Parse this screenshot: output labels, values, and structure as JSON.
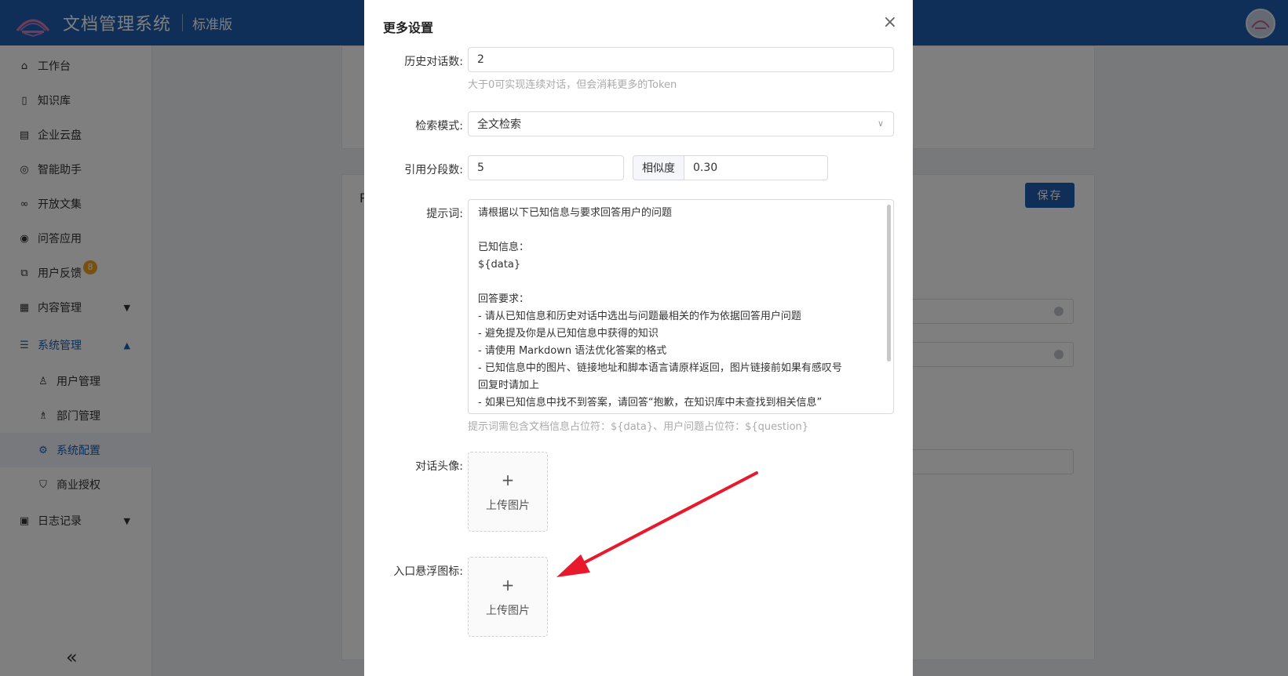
{
  "header": {
    "app_title": "文档管理系统",
    "edition": "标准版"
  },
  "sidebar": {
    "items": [
      {
        "label": "工作台",
        "icon": "home-icon"
      },
      {
        "label": "知识库",
        "icon": "book-icon"
      },
      {
        "label": "企业云盘",
        "icon": "cloud-drive-icon"
      },
      {
        "label": "智能助手",
        "icon": "chat-icon"
      },
      {
        "label": "开放文集",
        "icon": "share-icon"
      },
      {
        "label": "问答应用",
        "icon": "qa-icon"
      },
      {
        "label": "用户反馈",
        "icon": "feedback-icon",
        "badge": "8"
      },
      {
        "label": "内容管理",
        "icon": "grid-icon"
      },
      {
        "label": "系统管理",
        "icon": "sliders-icon"
      },
      {
        "label": "用户管理",
        "icon": "user-icon"
      },
      {
        "label": "部门管理",
        "icon": "team-icon"
      },
      {
        "label": "系统配置",
        "icon": "gear-icon"
      },
      {
        "label": "商业授权",
        "icon": "shield-icon"
      },
      {
        "label": "日志记录",
        "icon": "log-icon"
      }
    ],
    "collapse": "«"
  },
  "background": {
    "save_label": "保存",
    "partial_heading": "P"
  },
  "modal": {
    "title": "更多设置",
    "close": "×",
    "history": {
      "label": "历史对话数:",
      "value": "2",
      "hint": "大于0可实现连续对话，但会消耗更多的Token"
    },
    "search_mode": {
      "label": "检索模式:",
      "value": "全文检索"
    },
    "segments": {
      "label": "引用分段数:",
      "value": "5",
      "similarity_label": "相似度",
      "similarity_value": "0.30"
    },
    "prompt": {
      "label": "提示词:",
      "lines": [
        "请根据以下已知信息与要求回答用户的问题",
        "",
        "已知信息：",
        "${data}",
        "",
        "回答要求：",
        "- 请从已知信息和历史对话中选出与问题最相关的作为依据回答用户问题",
        "- 避免提及你是从已知信息中获得的知识",
        "- 请使用 Markdown 语法优化答案的格式",
        "- 已知信息中的图片、链接地址和脚本语言请原样返回，图片链接前如果有感叹号",
        "回复时请加上",
        "- 如果已知信息中找不到答案，请回答“抱歉，在知识库中未查找到相关信息”"
      ],
      "hint": "提示词需包含文档信息占位符：${data}、用户问题占位符：${question}"
    },
    "avatar": {
      "label": "对话头像:",
      "plus": "+",
      "upload_label": "上传图片"
    },
    "float_icon": {
      "label": "入口悬浮图标:",
      "plus": "+",
      "upload_label": "上传图片"
    }
  },
  "colors": {
    "brand": "#1f5fb3",
    "annotation_arrow": "#e8192c"
  }
}
